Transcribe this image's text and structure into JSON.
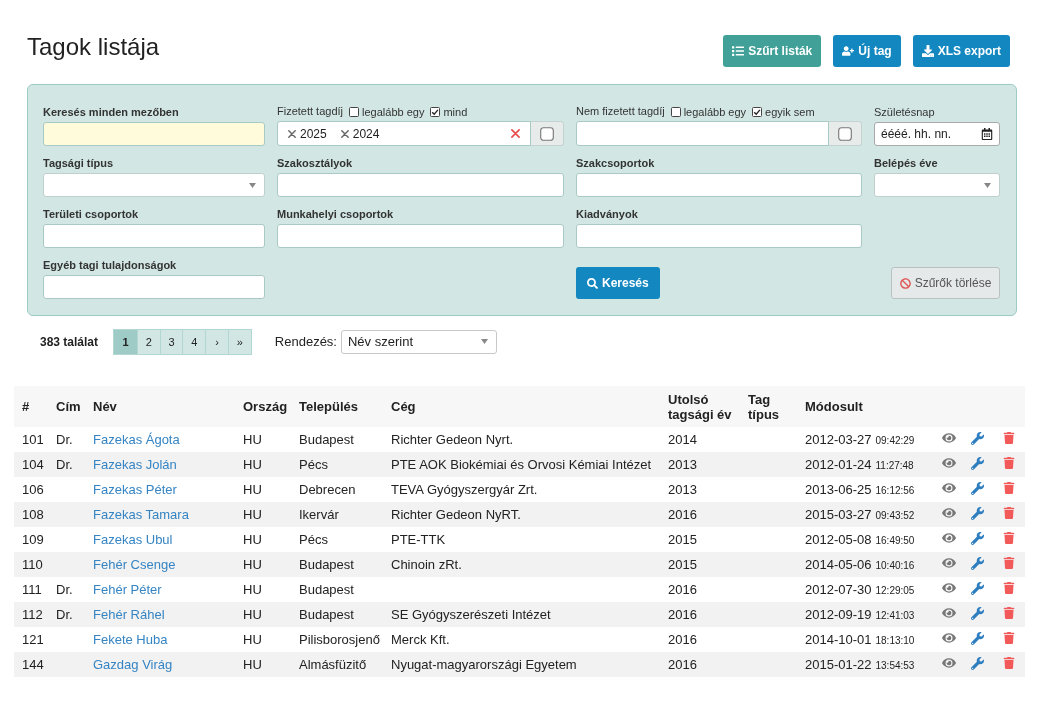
{
  "page": {
    "title": "Tagok listája"
  },
  "actions": [
    {
      "kind": "lists",
      "label": "Szűrt listák"
    },
    {
      "kind": "add-user",
      "label": "Új tag"
    },
    {
      "kind": "export",
      "label": "XLS export"
    }
  ],
  "filters": {
    "rows": [
      [
        {
          "kind": "text",
          "label": "Keresés minden mezőben",
          "highlighted": true
        },
        {
          "kind": "tags",
          "label": "Fizetett tagdíj",
          "highlighted": false,
          "options": [
            {
              "label": "legalább egy",
              "checked": false
            },
            {
              "label": "mind",
              "checked": true
            }
          ],
          "tags": [
            "2025",
            "2024"
          ],
          "checked": false
        },
        {
          "kind": "tags",
          "label": "Nem fizetett tagdíj",
          "highlighted": false,
          "options": [
            {
              "label": "legalább egy",
              "checked": false
            },
            {
              "label": "egyik sem",
              "checked": true
            }
          ],
          "checked": false
        },
        {
          "kind": "date",
          "label": "Születésnap",
          "highlighted": false,
          "placeholder": "éééé. hh. nn."
        }
      ],
      [
        {
          "kind": "select",
          "label": "Tagsági típus",
          "highlighted": false
        },
        {
          "kind": "text",
          "label": "Szakosztályok",
          "highlighted": false
        },
        {
          "kind": "text",
          "label": "Szakcsoportok",
          "highlighted": false
        },
        {
          "kind": "select",
          "label": "Belépés éve",
          "highlighted": false
        }
      ],
      [
        {
          "kind": "text",
          "label": "Területi csoportok",
          "highlighted": false
        },
        {
          "kind": "text",
          "label": "Munkahelyi csoportok",
          "highlighted": false
        },
        {
          "kind": "text",
          "label": "Kiadványok",
          "highlighted": false
        }
      ],
      [
        {
          "kind": "text",
          "label": "Egyéb tagi tulajdonságok",
          "highlighted": false
        },
        "",
        {
          "kind": "search",
          "label": "Keresés"
        },
        {
          "kind": "clear",
          "label": "Szűrők törlése"
        }
      ]
    ]
  },
  "results": {
    "count": "383 találat",
    "pages": [
      {
        "label": "1",
        "selected": true
      },
      {
        "label": "2",
        "selected": false
      },
      {
        "label": "3",
        "selected": false
      },
      {
        "label": "4",
        "selected": false
      },
      {
        "label": "›",
        "selected": false
      },
      {
        "label": "»",
        "selected": false
      }
    ],
    "sort": {
      "label": "Rendezés:",
      "value": "Név szerint"
    }
  },
  "table": {
    "columns": [
      "#",
      "Cím",
      "Név",
      "Ország",
      "Település",
      "Cég",
      "Utolsó tagsági év",
      "Tag típus",
      "Módosult"
    ],
    "rows": [
      {
        "id": "101",
        "title": "Dr.",
        "name": "Fazekas Ágota",
        "country": "HU",
        "city": "Budapest",
        "company": "Richter Gedeon Nyrt.",
        "last_year": "2014",
        "modified_date": "2012-03-27",
        "modified_time": "09:42:29"
      },
      {
        "id": "104",
        "title": "Dr.",
        "name": "Fazekas Jolán",
        "country": "HU",
        "city": "Pécs",
        "company": "PTE AOK Biokémiai és Orvosi Kémiai Intézet",
        "last_year": "2013",
        "modified_date": "2012-01-24",
        "modified_time": "11:27:48"
      },
      {
        "id": "106",
        "name": "Fazekas Péter",
        "country": "HU",
        "city": "Debrecen",
        "company": "TEVA Gyógyszergyár Zrt.",
        "last_year": "2013",
        "modified_date": "2013-06-25",
        "modified_time": "16:12:56"
      },
      {
        "id": "108",
        "name": "Fazekas Tamara",
        "country": "HU",
        "city": "Ikervár",
        "company": "Richter Gedeon NyRT.",
        "last_year": "2016",
        "modified_date": "2015-03-27",
        "modified_time": "09:43:52"
      },
      {
        "id": "109",
        "name": "Fazekas Ubul",
        "country": "HU",
        "city": "Pécs",
        "company": "PTE-TTK",
        "last_year": "2015",
        "modified_date": "2012-05-08",
        "modified_time": "16:49:50"
      },
      {
        "id": "110",
        "name": "Fehér Csenge",
        "country": "HU",
        "city": "Budapest",
        "company": "Chinoin zRt.",
        "last_year": "2015",
        "modified_date": "2014-05-06",
        "modified_time": "10:40:16"
      },
      {
        "id": "111",
        "title": "Dr.",
        "name": "Fehér Péter",
        "country": "HU",
        "city": "Budapest",
        "last_year": "2016",
        "modified_date": "2012-07-30",
        "modified_time": "12:29:05"
      },
      {
        "id": "112",
        "title": "Dr.",
        "name": "Fehér Ráhel",
        "country": "HU",
        "city": "Budapest",
        "company": "SE Gyógyszerészeti Intézet",
        "last_year": "2016",
        "modified_date": "2012-09-19",
        "modified_time": "12:41:03"
      },
      {
        "id": "121",
        "name": "Fekete Huba",
        "country": "HU",
        "city": "Pilisborosjenő",
        "company": "Merck Kft.",
        "last_year": "2016",
        "modified_date": "2014-10-01",
        "modified_time": "18:13:10"
      },
      {
        "id": "144",
        "name": "Gazdag Virág",
        "country": "HU",
        "city": "Almásfüzitő",
        "company": "Nyugat-magyarországi Egyetem",
        "last_year": "2016",
        "modified_date": "2015-01-22",
        "modified_time": "13:54:53"
      }
    ]
  }
}
